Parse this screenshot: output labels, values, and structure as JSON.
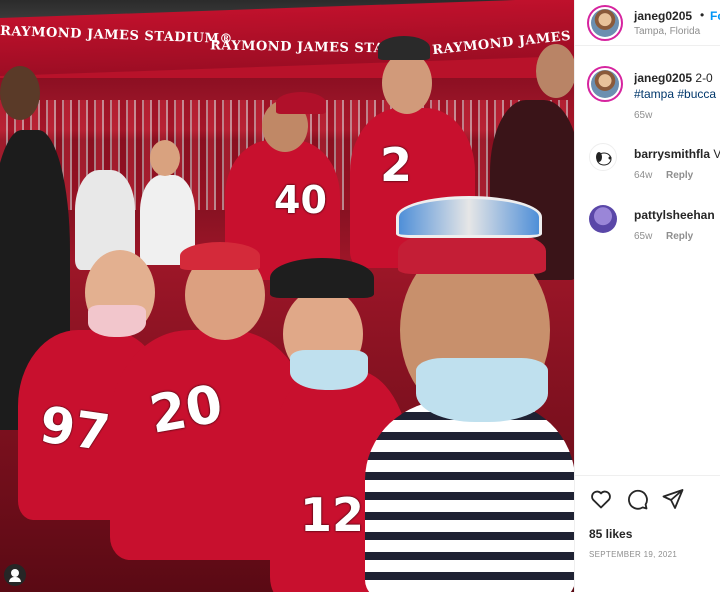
{
  "photo": {
    "banner_texts": [
      "RAYMOND JAMES STADIUM®",
      "RAYMOND JAMES STADI",
      "RAYMOND JAMES"
    ],
    "jersey_numbers": [
      "40",
      "2",
      "97",
      "20",
      "12"
    ],
    "colors": {
      "team_red": "#c8102e",
      "banner_red": "#b8122a"
    }
  },
  "header": {
    "username": "janeg0205",
    "separator": "•",
    "follow_label": "Fo",
    "location": "Tampa, Florida"
  },
  "caption": {
    "username": "janeg0205",
    "text": "2-0",
    "hashtags": "#tampa #bucca",
    "age": "65w"
  },
  "comments": [
    {
      "username": "barrysmithfla",
      "text": "V",
      "age": "64w",
      "reply_label": "Reply",
      "avatar_icon": "snoopy-avatar-icon"
    },
    {
      "username": "pattylsheehan",
      "text": "",
      "age": "65w",
      "reply_label": "Reply",
      "avatar_icon": "purple-avatar-icon"
    }
  ],
  "actions": {
    "icons": [
      "heart-icon",
      "comment-icon",
      "share-icon"
    ]
  },
  "likes": "85 likes",
  "date": "SEPTEMBER 19, 2021",
  "colors": {
    "link_blue": "#0095f6",
    "hashtag_blue": "#00376b",
    "muted": "#8e8e8e",
    "text": "#262626"
  }
}
